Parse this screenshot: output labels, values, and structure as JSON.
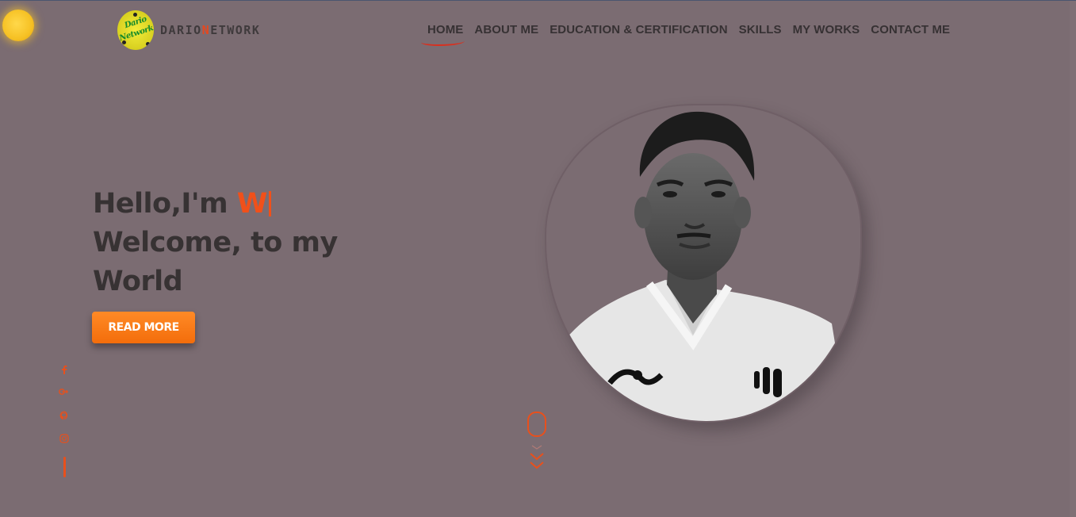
{
  "brand": {
    "logo_line1": "Dario",
    "logo_line2": "Network",
    "name_before": "DARIO",
    "name_accent": "N",
    "name_after": "ETWORK"
  },
  "nav": {
    "items": [
      {
        "label": "HOME",
        "active": true
      },
      {
        "label": "ABOUT ME"
      },
      {
        "label": "EDUCATION & CERTIFICATION"
      },
      {
        "label": "SKILLS"
      },
      {
        "label": "MY WORKS"
      },
      {
        "label": "CONTACT ME"
      }
    ]
  },
  "hero": {
    "greeting": "Hello,I'm ",
    "typed_name": "W",
    "line2": "Welcome, to my",
    "line3": "World",
    "cta_label": "READ MORE"
  },
  "social": {
    "icons": [
      "facebook-icon",
      "google-plus-icon",
      "github-icon",
      "instagram-icon"
    ]
  },
  "colors": {
    "background": "#7b6c72",
    "accent": "#f0501a",
    "text": "#373233",
    "button": "#f57a14"
  }
}
